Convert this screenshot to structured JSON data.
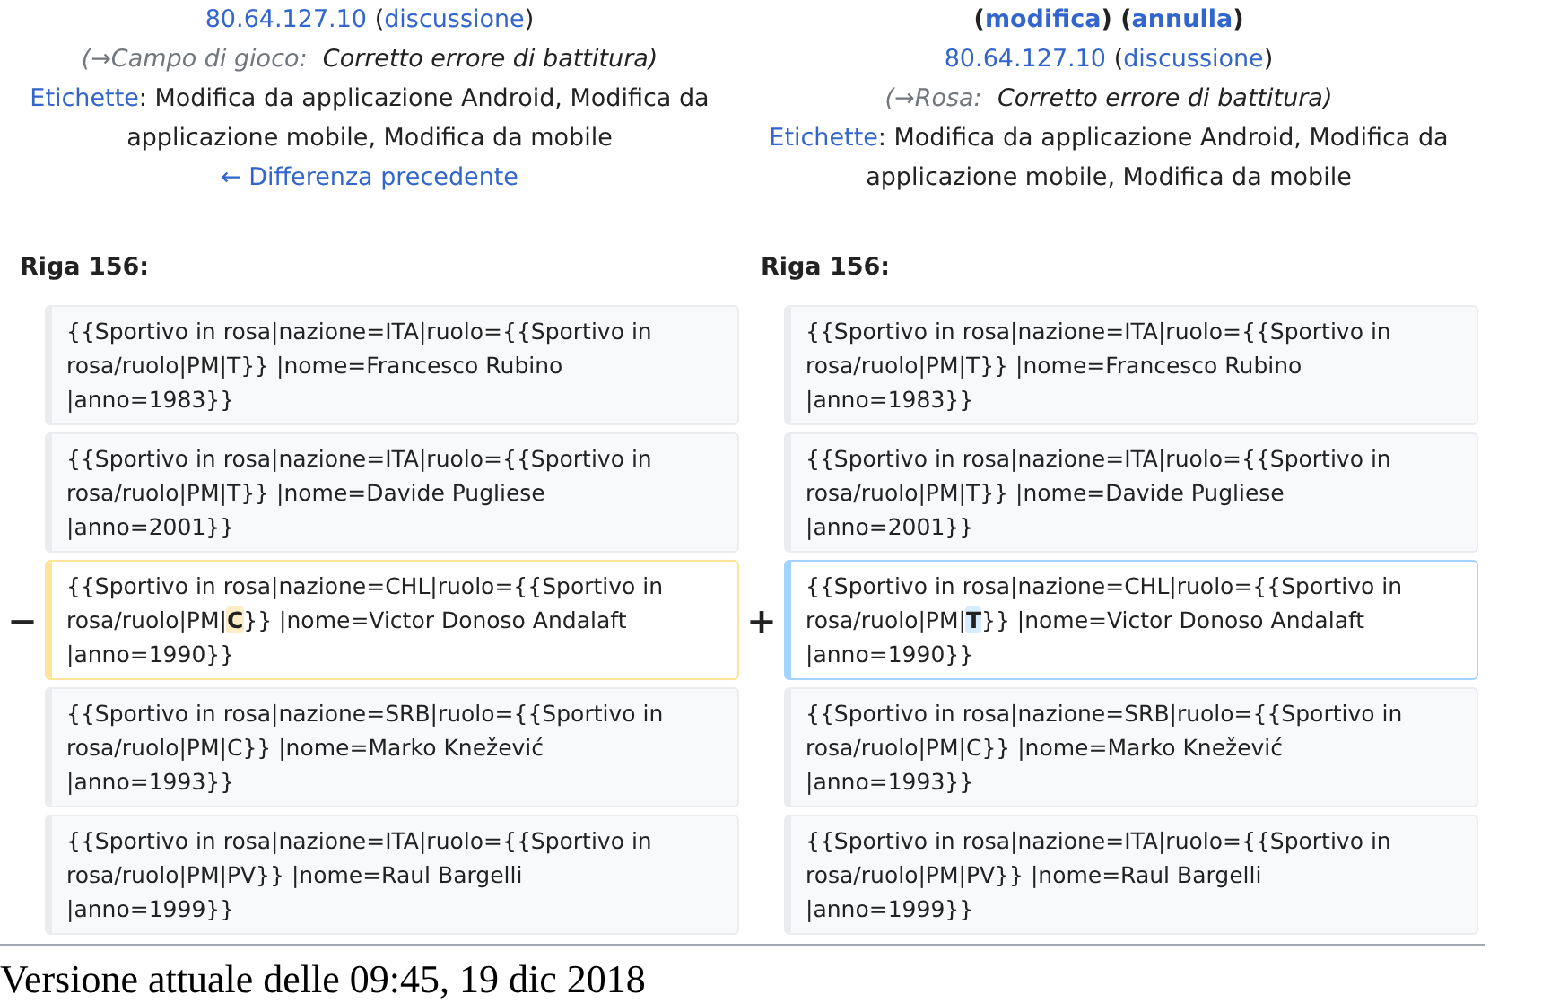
{
  "header": {
    "left": [
      [
        {
          "kind": "link",
          "text": "80.64.127.10"
        },
        {
          "kind": "text",
          "text": " ("
        },
        {
          "kind": "link",
          "text": "discussione"
        },
        {
          "kind": "text",
          "text": ")"
        }
      ],
      [
        {
          "kind": "muted",
          "text": "(→Campo di gioco:"
        },
        {
          "kind": "italic",
          "text": "  Corretto errore di battitura)"
        }
      ],
      [
        {
          "kind": "link",
          "text": "Etichette"
        },
        {
          "kind": "text",
          "text": ": Modifica da applicazione Android, Modifica da applicazione mobile, Modifica da mobile"
        }
      ],
      [
        {
          "kind": "link",
          "text": "← Differenza precedente"
        }
      ]
    ],
    "right": [
      [
        {
          "kind": "bold",
          "text": "("
        },
        {
          "kind": "boldlink",
          "text": "modifica"
        },
        {
          "kind": "bold",
          "text": ") ("
        },
        {
          "kind": "boldlink",
          "text": "annulla"
        },
        {
          "kind": "bold",
          "text": ")"
        }
      ],
      [
        {
          "kind": "link",
          "text": "80.64.127.10"
        },
        {
          "kind": "text",
          "text": " ("
        },
        {
          "kind": "link",
          "text": "discussione"
        },
        {
          "kind": "text",
          "text": ")"
        }
      ],
      [
        {
          "kind": "muted",
          "text": "(→Rosa:"
        },
        {
          "kind": "italic",
          "text": "  Corretto errore di battitura)"
        }
      ],
      [
        {
          "kind": "link",
          "text": "Etichette"
        },
        {
          "kind": "text",
          "text": ": Modifica da applicazione Android, Modifica da applicazione mobile, Modifica da mobile"
        }
      ]
    ]
  },
  "line_label_left": "Riga 156:",
  "line_label_right": "Riga 156:",
  "rows": [
    {
      "kind": "context",
      "left": [
        {
          "text": "{{Sportivo in rosa|nazione=ITA|ruolo={{Sportivo in rosa/ruolo|PM|T}} |nome=Francesco Rubino\n|anno=1983}}",
          "changed": false
        }
      ],
      "right": [
        {
          "text": "{{Sportivo in rosa|nazione=ITA|ruolo={{Sportivo in rosa/ruolo|PM|T}} |nome=Francesco Rubino\n|anno=1983}}",
          "changed": false
        }
      ]
    },
    {
      "kind": "context",
      "left": [
        {
          "text": "{{Sportivo in rosa|nazione=ITA|ruolo={{Sportivo in rosa/ruolo|PM|T}} |nome=Davide Pugliese\n|anno=2001}}",
          "changed": false
        }
      ],
      "right": [
        {
          "text": "{{Sportivo in rosa|nazione=ITA|ruolo={{Sportivo in rosa/ruolo|PM|T}} |nome=Davide Pugliese\n|anno=2001}}",
          "changed": false
        }
      ]
    },
    {
      "kind": "change",
      "left_marker": "−",
      "right_marker": "+",
      "left": [
        {
          "text": "{{Sportivo in rosa|nazione=CHL|ruolo={{Sportivo in rosa/ruolo|PM|",
          "changed": false
        },
        {
          "text": "C",
          "changed": true
        },
        {
          "text": "}} |nome=Victor Donoso Andalaft\n|anno=1990}}",
          "changed": false
        }
      ],
      "right": [
        {
          "text": "{{Sportivo in rosa|nazione=CHL|ruolo={{Sportivo in rosa/ruolo|PM|",
          "changed": false
        },
        {
          "text": "T",
          "changed": true
        },
        {
          "text": "}} |nome=Victor Donoso Andalaft\n|anno=1990}}",
          "changed": false
        }
      ]
    },
    {
      "kind": "context",
      "left": [
        {
          "text": "{{Sportivo in rosa|nazione=SRB|ruolo={{Sportivo in rosa/ruolo|PM|C}} |nome=Marko Knežević\n|anno=1993}}",
          "changed": false
        }
      ],
      "right": [
        {
          "text": "{{Sportivo in rosa|nazione=SRB|ruolo={{Sportivo in rosa/ruolo|PM|C}} |nome=Marko Knežević\n|anno=1993}}",
          "changed": false
        }
      ]
    },
    {
      "kind": "context",
      "left": [
        {
          "text": "{{Sportivo in rosa|nazione=ITA|ruolo={{Sportivo in rosa/ruolo|PM|PV}} |nome=Raul Bargelli\n|anno=1999}}",
          "changed": false
        }
      ],
      "right": [
        {
          "text": "{{Sportivo in rosa|nazione=ITA|ruolo={{Sportivo in rosa/ruolo|PM|PV}} |nome=Raul Bargelli\n|anno=1999}}",
          "changed": false
        }
      ]
    }
  ],
  "current_version": "Versione attuale delle 09:45, 19 dic 2018"
}
